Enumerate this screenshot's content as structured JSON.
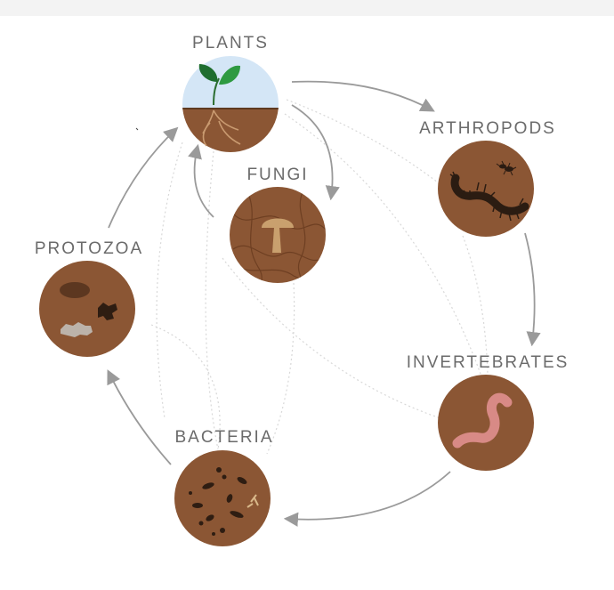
{
  "diagram": {
    "nodes": {
      "plants": {
        "label": "PLANTS",
        "icon": "seedling-icon"
      },
      "arthropods": {
        "label": "ARTHROPODS",
        "icon": "centipede-icon"
      },
      "fungi": {
        "label": "FUNGI",
        "icon": "mushroom-icon"
      },
      "protozoa": {
        "label": "PROTOZOA",
        "icon": "protozoa-icon"
      },
      "invertebrates": {
        "label": "INVERTEBRATES",
        "icon": "earthworm-icon"
      },
      "bacteria": {
        "label": "BACTERIA",
        "icon": "bacteria-icon"
      }
    },
    "colors": {
      "soil": "#8b5634",
      "soil_light": "#a86e45",
      "sky": "#d4e6f6",
      "leaf": "#2e9a41",
      "leaf_dark": "#1f6e2f",
      "arrow": "#9a9a9a",
      "faint_link": "#d8d8d8",
      "label": "#6b6b6b"
    }
  }
}
